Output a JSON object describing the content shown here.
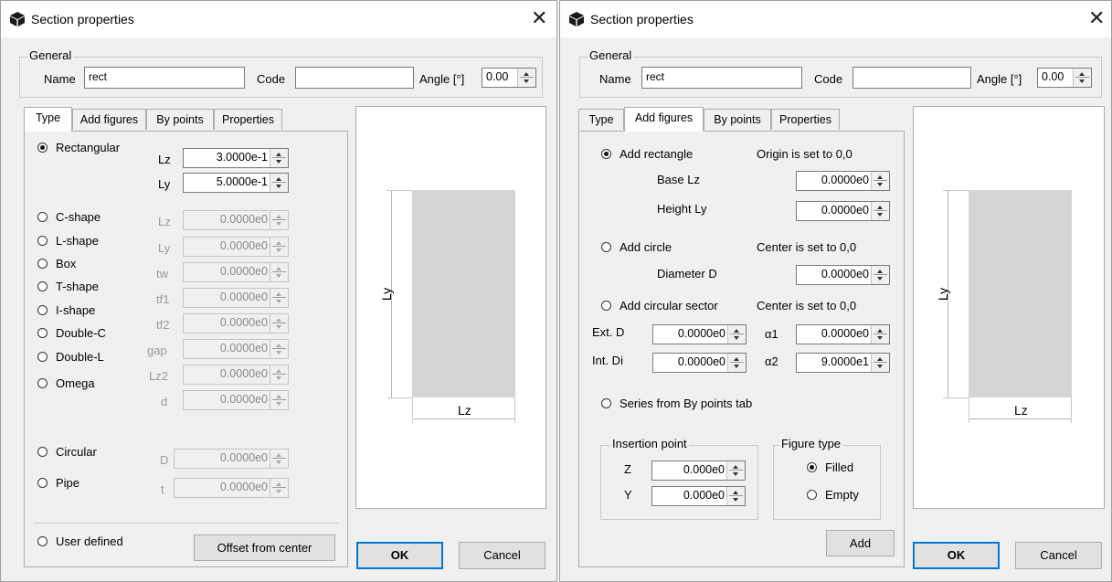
{
  "dialogs": [
    {
      "title": "Section properties",
      "close": "✕",
      "general": {
        "legend": "General",
        "name_label": "Name",
        "name_value": "rect",
        "code_label": "Code",
        "code_value": "",
        "angle_label": "Angle [°]",
        "angle_value": "0.00"
      },
      "tabs": [
        "Type",
        "Add figures",
        "By points",
        "Properties"
      ],
      "active_tab": "Type",
      "preview": {
        "ly_label": "Ly",
        "lz_label": "Lz"
      },
      "ok_label": "OK",
      "cancel_label": "Cancel"
    },
    {
      "title": "Section properties",
      "close": "✕",
      "general": {
        "legend": "General",
        "name_label": "Name",
        "name_value": "rect",
        "code_label": "Code",
        "code_value": "",
        "angle_label": "Angle [°]",
        "angle_value": "0.00"
      },
      "tabs": [
        "Type",
        "Add figures",
        "By points",
        "Properties"
      ],
      "active_tab": "Add figures",
      "preview": {
        "ly_label": "Ly",
        "lz_label": "Lz"
      },
      "ok_label": "OK",
      "cancel_label": "Cancel"
    }
  ],
  "type_tab": {
    "rectangular": {
      "label": "Rectangular",
      "selected": true,
      "lz_label": "Lz",
      "lz_value": "3.0000e-1",
      "ly_label": "Ly",
      "ly_value": "5.0000e-1"
    },
    "shapes": [
      {
        "label": "C-shape",
        "param": "Lz",
        "value": "0.0000e0"
      },
      {
        "label": "L-shape",
        "param": "Ly",
        "value": "0.0000e0"
      },
      {
        "label": "Box",
        "param": "tw",
        "value": "0.0000e0"
      },
      {
        "label": "T-shape",
        "param": "tf1",
        "value": "0.0000e0"
      },
      {
        "label": "I-shape",
        "param": "tf2",
        "value": "0.0000e0"
      },
      {
        "label": "Double-C",
        "param": "gap",
        "value": "0.0000e0"
      },
      {
        "label": "Double-L",
        "param": "Lz2",
        "value": "0.0000e0"
      },
      {
        "label": "Omega",
        "param": "d",
        "value": "0.0000e0"
      }
    ],
    "circular": {
      "label": "Circular",
      "param": "D",
      "value": "0.0000e0"
    },
    "pipe": {
      "label": "Pipe",
      "param": "t",
      "value": "0.0000e0"
    },
    "user_defined": {
      "label": "User defined"
    },
    "offset_button": "Offset from center"
  },
  "add_figures_tab": {
    "add_rectangle": {
      "label": "Add rectangle",
      "selected": true,
      "note": "Origin is set to 0,0",
      "base_label": "Base Lz",
      "base_value": "0.0000e0",
      "height_label": "Height Ly",
      "height_value": "0.0000e0"
    },
    "add_circle": {
      "label": "Add circle",
      "note": "Center is set to 0,0",
      "diameter_label": "Diameter D",
      "diameter_value": "0.0000e0"
    },
    "add_sector": {
      "label": "Add circular sector",
      "note": "Center is set to 0,0",
      "ext_label": "Ext. D",
      "ext_value": "0.0000e0",
      "int_label": "Int. Di",
      "int_value": "0.0000e0",
      "a1_label": "α1",
      "a1_value": "0.0000e0",
      "a2_label": "α2",
      "a2_value": "9.0000e1"
    },
    "series": {
      "label": "Series from By points tab"
    },
    "insertion": {
      "legend": "Insertion point",
      "z_label": "Z",
      "z_value": "0.000e0",
      "y_label": "Y",
      "y_value": "0.000e0"
    },
    "figure_type": {
      "legend": "Figure type",
      "filled_label": "Filled",
      "empty_label": "Empty",
      "selected": "Filled"
    },
    "add_button": "Add"
  },
  "colors": {
    "section_fill": "#d4d4d4",
    "default_button_border": "#0078d7",
    "icon": "#1a1a1a"
  },
  "icons": {
    "title_icon": "cube-icon"
  }
}
